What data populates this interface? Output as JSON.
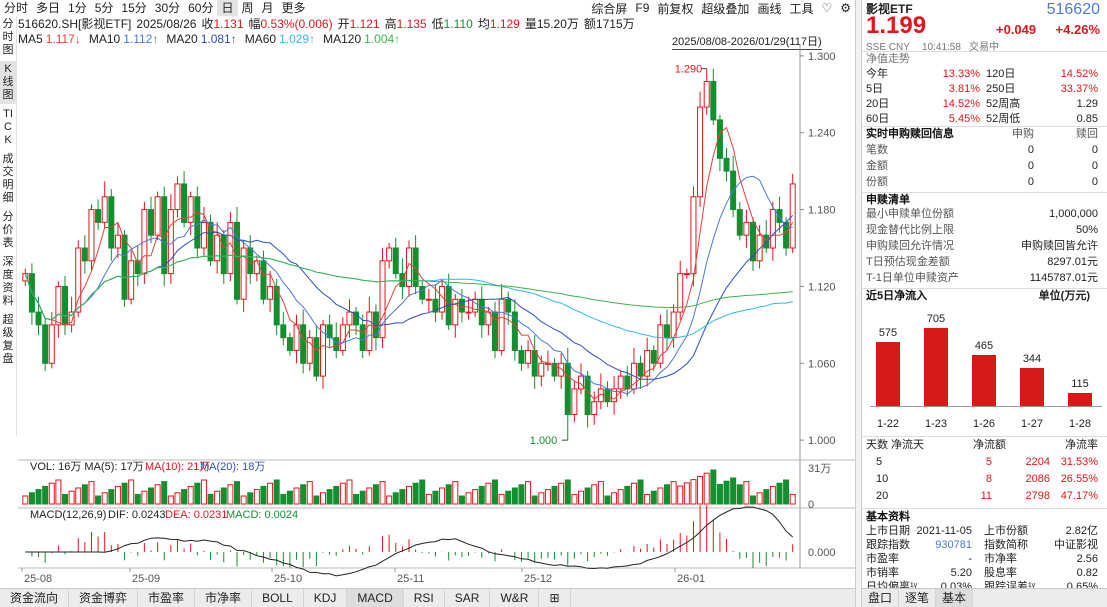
{
  "colors": {
    "up": "#e4151a",
    "down": "#138f2f",
    "ma5": "#e0423a",
    "ma10": "#4d78d8",
    "ma20": "#2e4fb8",
    "ma60": "#33b9e8",
    "ma120": "#3cb44b"
  },
  "timeframes": [
    "分时",
    "多日",
    "1分",
    "5分",
    "15分",
    "30分",
    "60分",
    "日",
    "周",
    "月",
    "更多"
  ],
  "timeframe_selected": "日",
  "right_tools": [
    "综合屏",
    "F9",
    "前复权",
    "超级叠加",
    "画线",
    "工具"
  ],
  "favorite_icon": "heart-icon",
  "settings_icon": "gear-icon",
  "info": {
    "code": "516620.SH[影视ETF]",
    "date": "2025/08/26",
    "shou_label": "收",
    "shou": "1.131",
    "fu_label": "幅",
    "fu": "0.53%(0.006)",
    "kai_label": "开",
    "kai": "1.121",
    "gao_label": "高",
    "gao": "1.135",
    "di_label": "低",
    "di": "1.110",
    "jun_label": "均",
    "jun": "1.129",
    "liang_label": "量",
    "liang": "15.20万",
    "e_label": "额",
    "e": "1715万"
  },
  "ma": [
    {
      "label": "MA5",
      "value": "1.117",
      "dir": "↓"
    },
    {
      "label": "MA10",
      "value": "1.112",
      "dir": "↑"
    },
    {
      "label": "MA20",
      "value": "1.081",
      "dir": "↑"
    },
    {
      "label": "MA60",
      "value": "1.029",
      "dir": "↑"
    },
    {
      "label": "MA120",
      "value": "1.004",
      "dir": "↑"
    }
  ],
  "date_range": "2025/08/08-2026/01/29(117日)",
  "left_nav": [
    "分时图",
    "K线图",
    "TICK",
    "成交明细",
    "分价表",
    "深度资料",
    "超级复盘"
  ],
  "left_nav_selected": 1,
  "chart_data": {
    "type": "candlestick",
    "y_ticks": [
      "1.300",
      "1.240",
      "1.180",
      "1.120",
      "1.060",
      "1.000"
    ],
    "ylim": [
      0.997,
      1.303
    ],
    "x_ticks": [
      "25-08",
      "25-09",
      "25-10",
      "25-11",
      "25-12",
      "26-01"
    ],
    "high_label": "1.290",
    "low_label": "1.000",
    "ohlc_path": [
      1.13,
      1.1,
      1.09,
      1.06,
      1.09,
      1.12,
      1.09,
      1.1,
      1.15,
      1.14,
      1.18,
      1.17,
      1.19,
      1.15,
      1.16,
      1.11,
      1.14,
      1.13,
      1.18,
      1.16,
      1.19,
      1.13,
      1.18,
      1.2,
      1.17,
      1.19,
      1.15,
      1.17,
      1.14,
      1.16,
      1.13,
      1.17,
      1.11,
      1.15,
      1.13,
      1.14,
      1.11,
      1.12,
      1.09,
      1.08,
      1.07,
      1.09,
      1.06,
      1.08,
      1.05,
      1.09,
      1.08,
      1.07,
      1.09,
      1.1,
      1.09,
      1.07,
      1.1,
      1.08,
      1.14,
      1.15,
      1.13,
      1.12,
      1.15,
      1.12,
      1.11,
      1.11,
      1.1,
      1.12,
      1.09,
      1.11,
      1.1,
      1.1,
      1.11,
      1.09,
      1.1,
      1.07,
      1.11,
      1.1,
      1.07,
      1.06,
      1.07,
      1.05,
      1.06,
      1.06,
      1.05,
      1.06,
      1.02,
      1.04,
      1.05,
      1.02,
      1.03,
      1.04,
      1.03,
      1.04,
      1.05,
      1.04,
      1.06,
      1.05,
      1.07,
      1.06,
      1.09,
      1.08,
      1.1,
      1.13,
      1.13,
      1.19,
      1.26,
      1.28,
      1.25,
      1.22,
      1.21,
      1.18,
      1.16,
      1.17,
      1.14,
      1.16,
      1.15,
      1.18,
      1.17,
      1.15,
      1.2
    ],
    "vol_label": "VOL: 16万  MA(5): 17万",
    "vol_ma10": "MA(10): 21万",
    "vol_ma20": "MA(20): 18万",
    "vol_ticks": [
      "31万",
      "0"
    ],
    "macd_label": "MACD(12,26,9)",
    "macd_dif": "DIF: 0.0243",
    "macd_dea": "DEA: 0.0231",
    "macd_val": "MACD: 0.0024",
    "macd_ticks": [
      "0.000"
    ]
  },
  "bottom_tabs": [
    "资金流向",
    "资金博弈",
    "市盈率",
    "市净率",
    "BOLL",
    "KDJ",
    "MACD",
    "RSI",
    "SAR",
    "W&R"
  ],
  "bottom_selected": "MACD",
  "right": {
    "name": "影视ETF",
    "code": "516620",
    "price": "1.199",
    "change": "+0.049",
    "pct": "+4.26%",
    "exch": "SSE  CNY",
    "time": "10:41:58",
    "status": "交易中",
    "perf_title": "净值走势",
    "perf": [
      [
        "今年",
        "13.33%",
        "120日",
        "14.52%"
      ],
      [
        "5日",
        "3.81%",
        "250日",
        "33.37%"
      ],
      [
        "20日",
        "14.52%",
        "52周高",
        "1.29"
      ],
      [
        "60日",
        "5.45%",
        "52周低",
        "0.85"
      ]
    ],
    "sub_title": "实时申购赎回信息",
    "sub_h1": "申购",
    "sub_h2": "赎回",
    "sub": [
      [
        "笔数",
        "0",
        "0"
      ],
      [
        "金额",
        "0",
        "0"
      ],
      [
        "份额",
        "0",
        "0"
      ]
    ],
    "list_title": "申赎清单",
    "list": [
      [
        "最小申赎单位份额",
        "1,000,000"
      ],
      [
        "现金替代比例上限",
        "50%"
      ],
      [
        "申购赎回允许情况",
        "申购赎回皆允许"
      ],
      [
        "T日预估现金差额",
        "8297.01元"
      ],
      [
        "T-1日单位申赎资产",
        "1145787.01元"
      ]
    ],
    "flow_title": "近5日净流入",
    "flow_unit": "单位(万元)",
    "flow": [
      {
        "d": "1-22",
        "v": 575
      },
      {
        "d": "1-23",
        "v": 705
      },
      {
        "d": "1-26",
        "v": 465
      },
      {
        "d": "1-27",
        "v": 344
      },
      {
        "d": "1-28",
        "v": 115
      }
    ],
    "flow_head": [
      "天数",
      "净流天",
      "净流额",
      "净流率"
    ],
    "flow_rows": [
      [
        "5",
        "5",
        "2204",
        "31.53%"
      ],
      [
        "10",
        "8",
        "2086",
        "26.55%"
      ],
      [
        "20",
        "11",
        "2798",
        "47.17%"
      ]
    ],
    "basic_title": "基本资料",
    "basic": [
      [
        "上市日期",
        "2021-11-05",
        "上市份额",
        "2.82亿"
      ],
      [
        "跟踪指数",
        "930781",
        "指数简称",
        "中证影视"
      ],
      [
        "市盈率",
        "-",
        "市净率",
        "2.56"
      ],
      [
        "市销率",
        "5.20",
        "股息率",
        "0.82"
      ],
      [
        "日均偏离¹ʸ",
        "0.03%",
        "跟踪误差¹ʸ",
        "0.65%"
      ]
    ],
    "bottom_tabs": [
      "盘口",
      "逐笔",
      "基本"
    ],
    "bottom_selected": "基本"
  }
}
